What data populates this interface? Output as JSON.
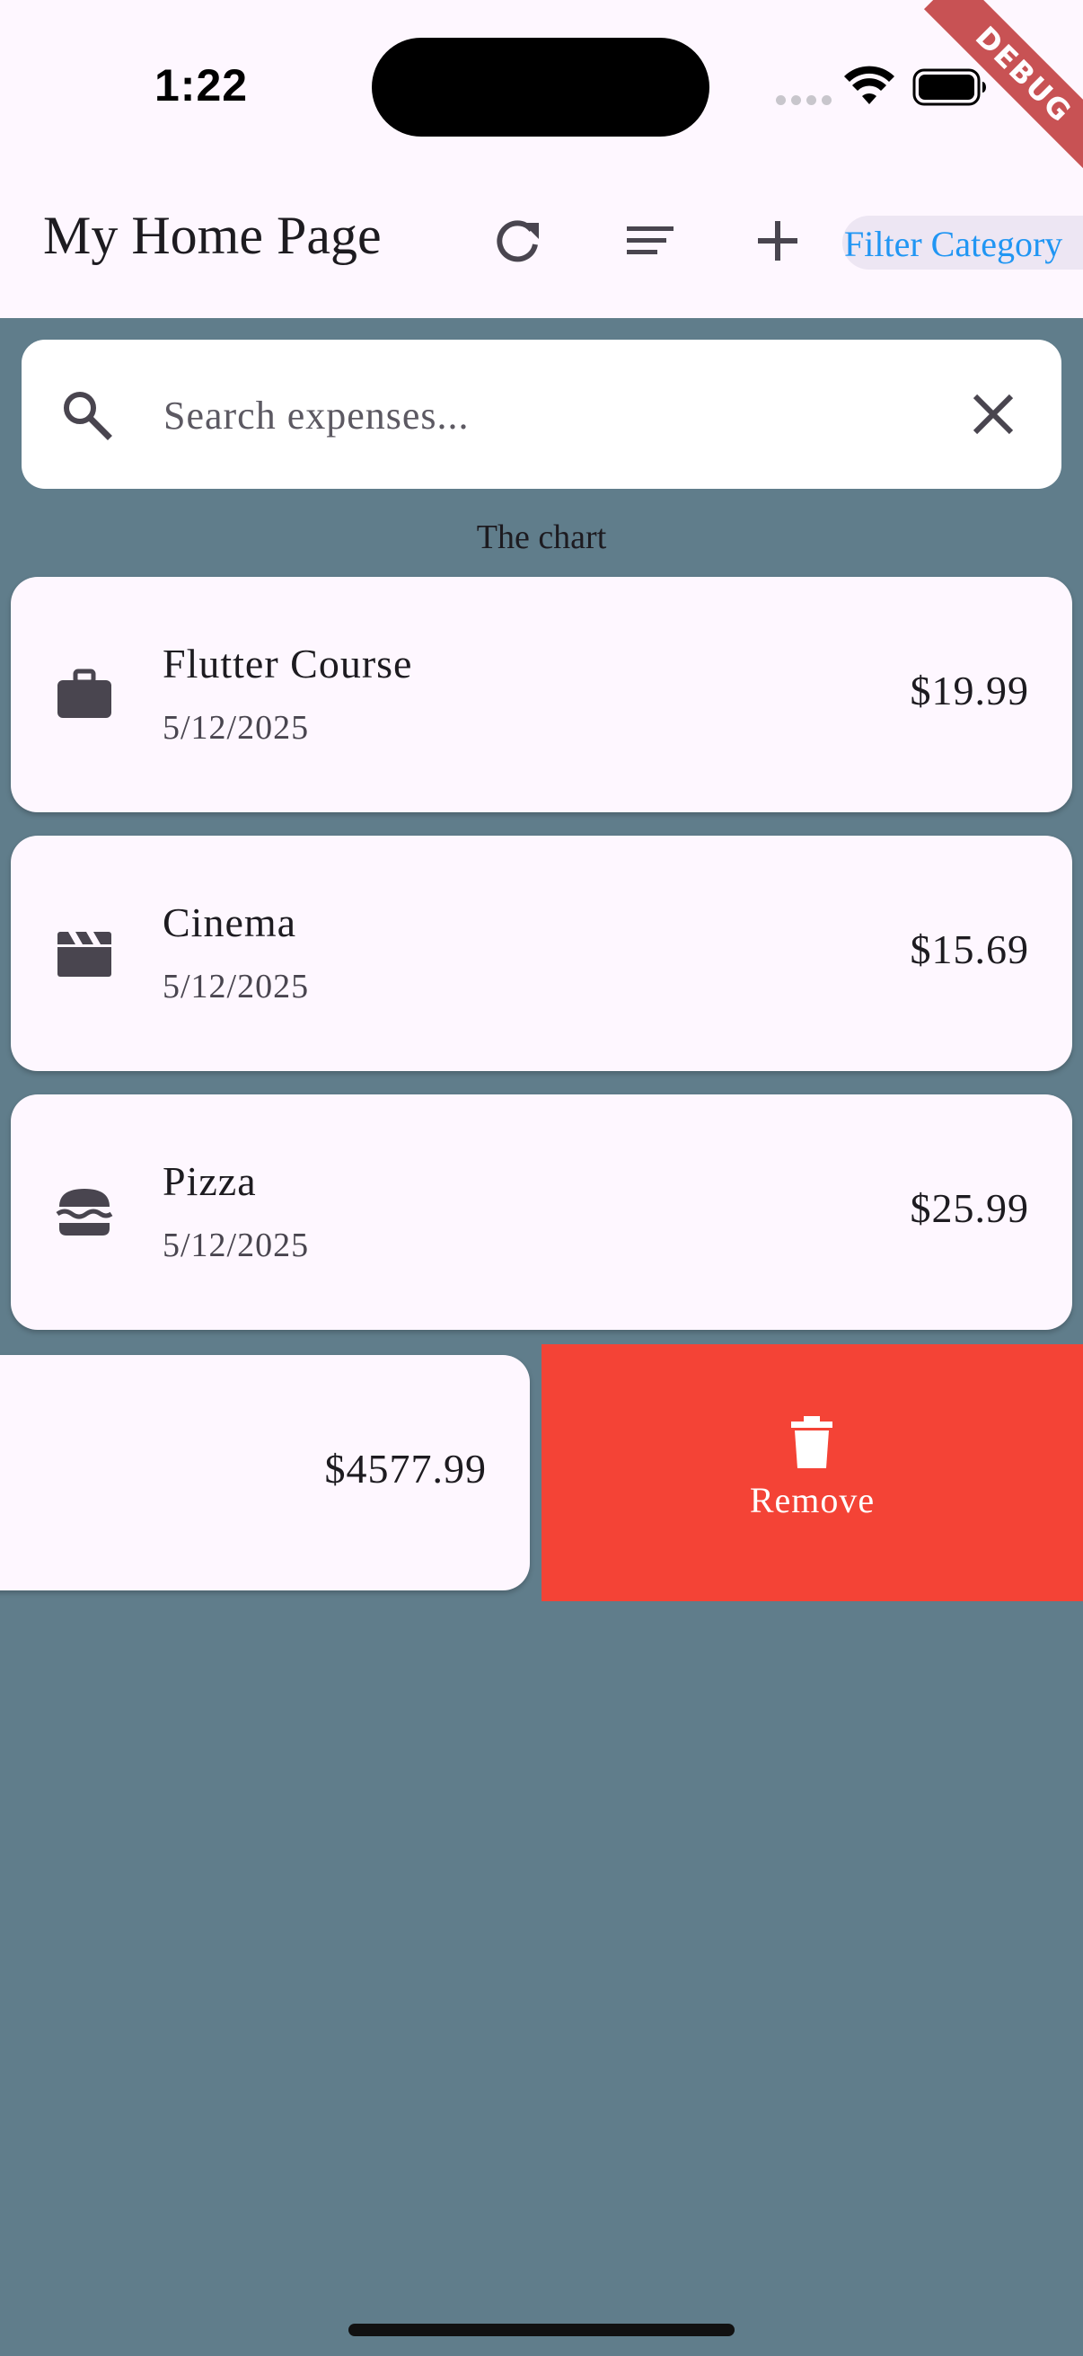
{
  "status_bar": {
    "time": "1:22"
  },
  "debug_banner": "DEBUG",
  "app_bar": {
    "title": "My Home Page",
    "actions": [
      "refresh-icon",
      "sort-icon",
      "add-icon"
    ],
    "filter_label": "Filter Category"
  },
  "search": {
    "placeholder": "Search expenses...",
    "value": ""
  },
  "chart_placeholder": "The chart",
  "expenses": [
    {
      "title": "Flutter Course",
      "date": "5/12/2025",
      "amount": "$19.99",
      "icon": "briefcase-icon"
    },
    {
      "title": "Cinema",
      "date": "5/12/2025",
      "amount": "$15.69",
      "icon": "movie-clapper-icon"
    },
    {
      "title": "Pizza",
      "date": "5/12/2025",
      "amount": "$25.99",
      "icon": "burger-icon"
    },
    {
      "title": "",
      "date": "",
      "amount": "$4577.99",
      "icon": ""
    }
  ],
  "dismiss_action": {
    "label": "Remove",
    "icon": "trash-icon",
    "color": "#f44336"
  },
  "colors": {
    "background": "#607d8b",
    "app_bar": "#fef7ff",
    "card": "#fef7ff",
    "accent": "#2196f3"
  }
}
